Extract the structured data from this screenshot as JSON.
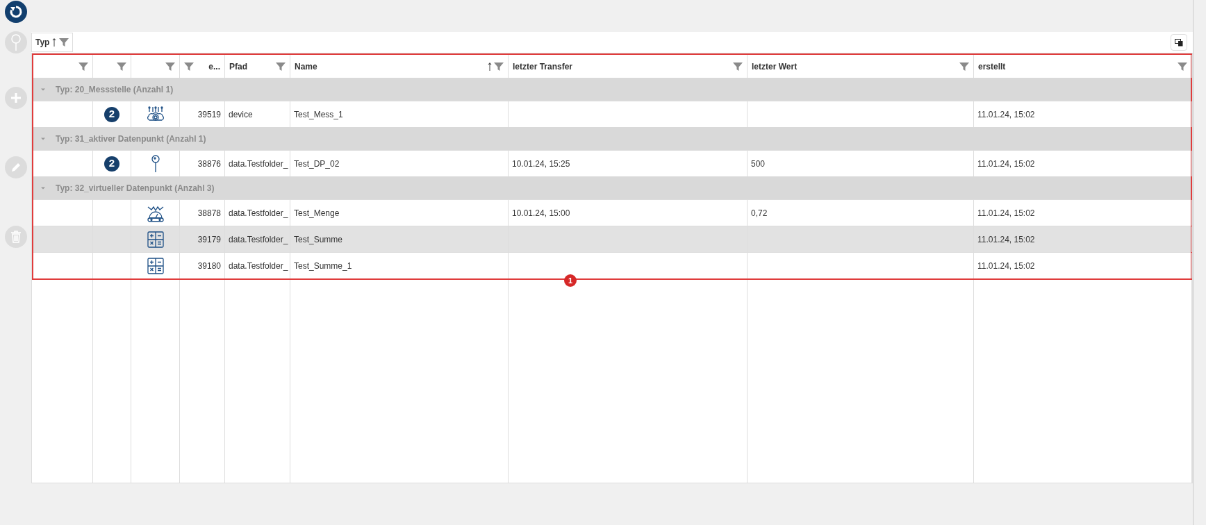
{
  "group_panel": {
    "label": "Typ",
    "sorted": true
  },
  "columns": [
    {
      "kind": "text",
      "sorted": false
    },
    {
      "kind": "text",
      "sorted": false
    },
    {
      "kind": "text",
      "sorted": false
    },
    {
      "label": "e...",
      "kind": "number",
      "sorted": false
    },
    {
      "label": "Pfad",
      "kind": "text",
      "sorted": false
    },
    {
      "label": "Name",
      "kind": "text",
      "sorted": true
    },
    {
      "label": "letzter Transfer",
      "kind": "text",
      "sorted": false
    },
    {
      "label": "letzter Wert",
      "kind": "text",
      "sorted": false
    },
    {
      "label": "erstellt",
      "kind": "text",
      "sorted": false
    }
  ],
  "groups": [
    {
      "title": "Typ: 20_Messstelle (Anzahl 1)",
      "expanded": true,
      "rows": [
        {
          "highlighted": false,
          "badge": "2",
          "kind": "sensor",
          "number": "39519",
          "path": "device",
          "name": "Test_Mess_1",
          "created": "11.01.24, 15:02"
        }
      ]
    },
    {
      "title": "Typ: 31_aktiver Datenpunkt (Anzahl 1)",
      "expanded": true,
      "rows": [
        {
          "highlighted": false,
          "badge": "2",
          "kind": "pin",
          "number": "38876",
          "path": "data.Testfolder_",
          "name": "Test_DP_02",
          "transfer": "10.01.24, 15:25",
          "value": "500",
          "created": "11.01.24, 15:02"
        }
      ]
    },
    {
      "title": "Typ: 32_virtueller Datenpunkt (Anzahl 3)",
      "expanded": true,
      "rows": [
        {
          "highlighted": false,
          "kind": "gauge",
          "number": "38878",
          "path": "data.Testfolder_",
          "name": "Test_Menge",
          "transfer": "10.01.24, 15:00",
          "value": "0,72",
          "created": "11.01.24, 15:02"
        },
        {
          "highlighted": true,
          "kind": "calculator",
          "number": "39179",
          "path": "data.Testfolder_",
          "name": "Test_Summe",
          "created": "11.01.24, 15:02"
        },
        {
          "highlighted": false,
          "kind": "calculator",
          "number": "39180",
          "path": "data.Testfolder_",
          "name": "Test_Summe_1",
          "created": "11.01.24, 15:02"
        }
      ]
    }
  ],
  "annotation_marker": "1"
}
